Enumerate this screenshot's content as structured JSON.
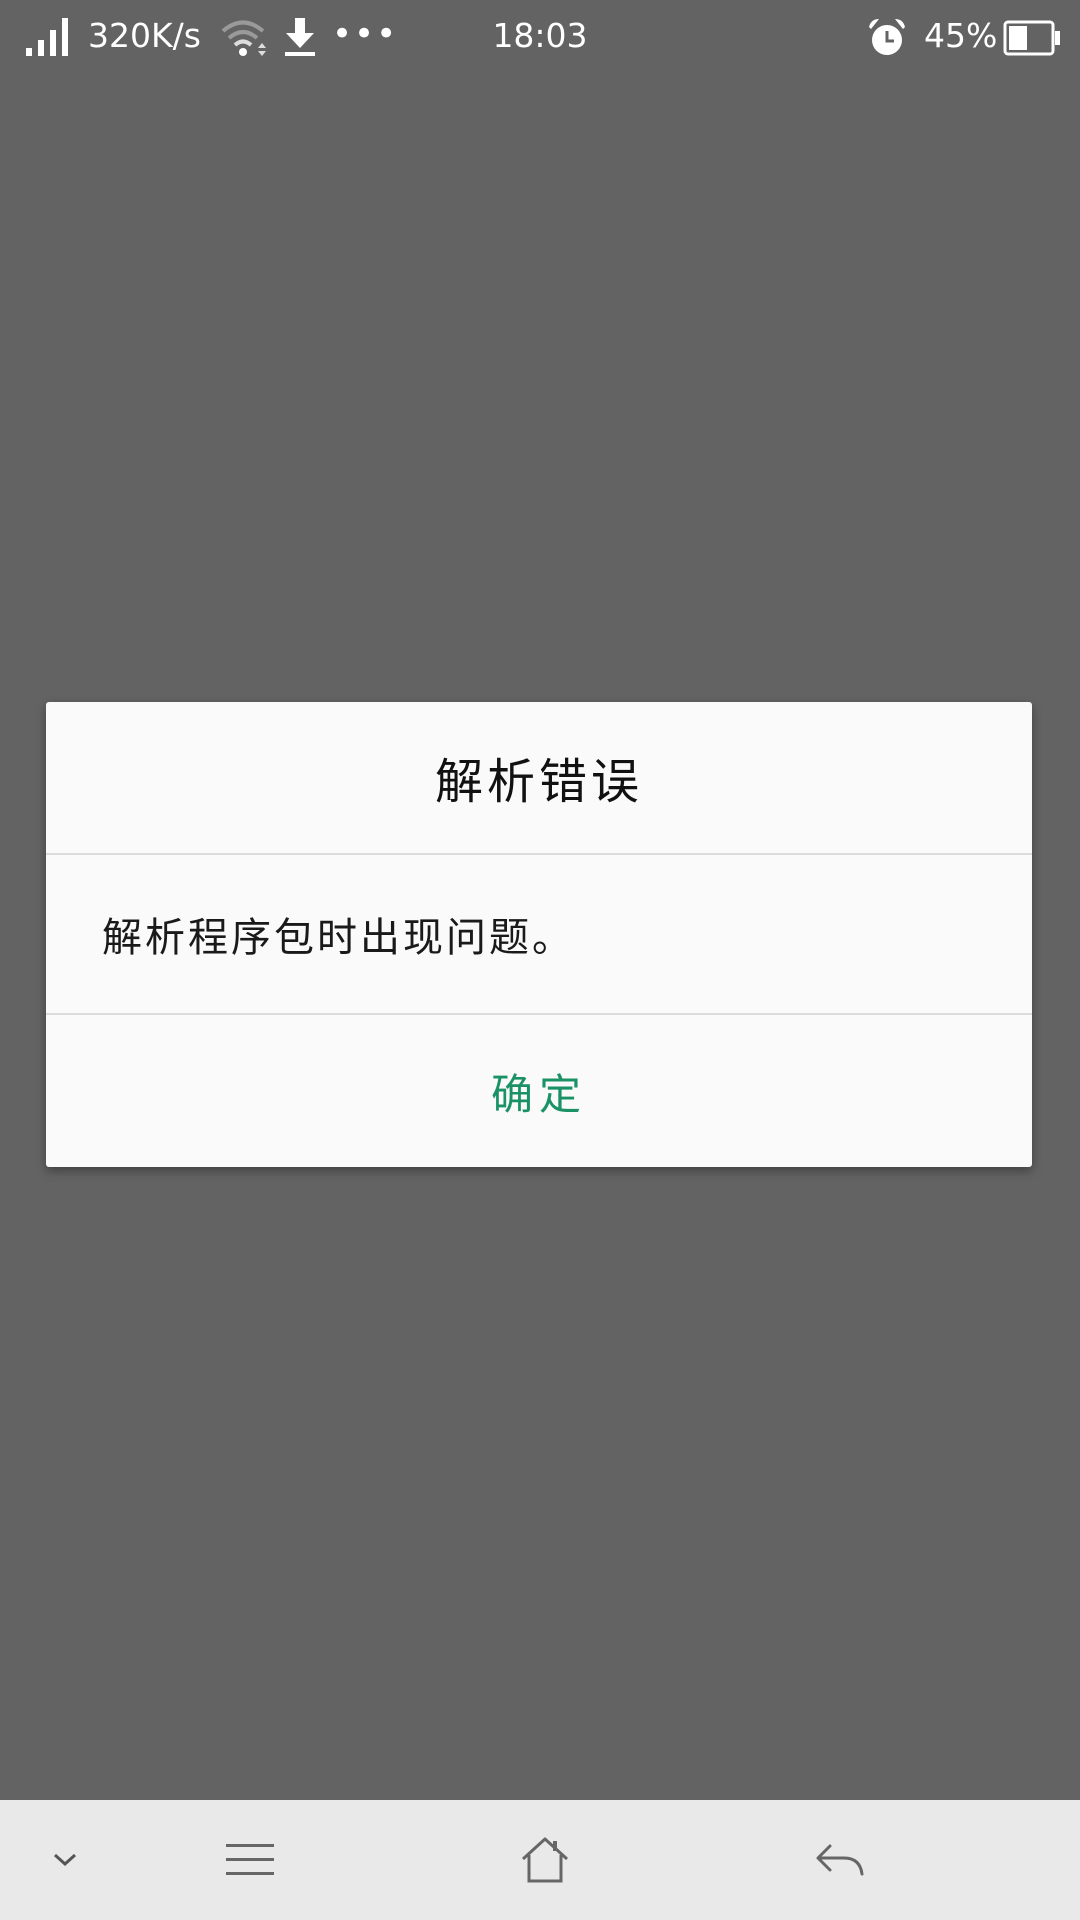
{
  "status_bar": {
    "net_speed": "320K/s",
    "time": "18:03",
    "battery_percent": "45%",
    "battery_level": 0.45,
    "icons": [
      "signal-icon",
      "wifi-icon",
      "download-icon",
      "more-icon",
      "alarm-icon",
      "battery-icon"
    ],
    "more_glyph": "•••"
  },
  "dialog": {
    "title": "解析错误",
    "message": "解析程序包时出现问题。",
    "confirm_label": "确定",
    "accent_color": "#1a9266"
  },
  "nav_bar": {
    "icons": [
      "collapse-icon",
      "menu-icon",
      "home-icon",
      "back-icon"
    ]
  },
  "colors": {
    "overlay": "#636363",
    "dialog_bg": "#fafafa",
    "nav_bg": "#e9e9e9"
  }
}
